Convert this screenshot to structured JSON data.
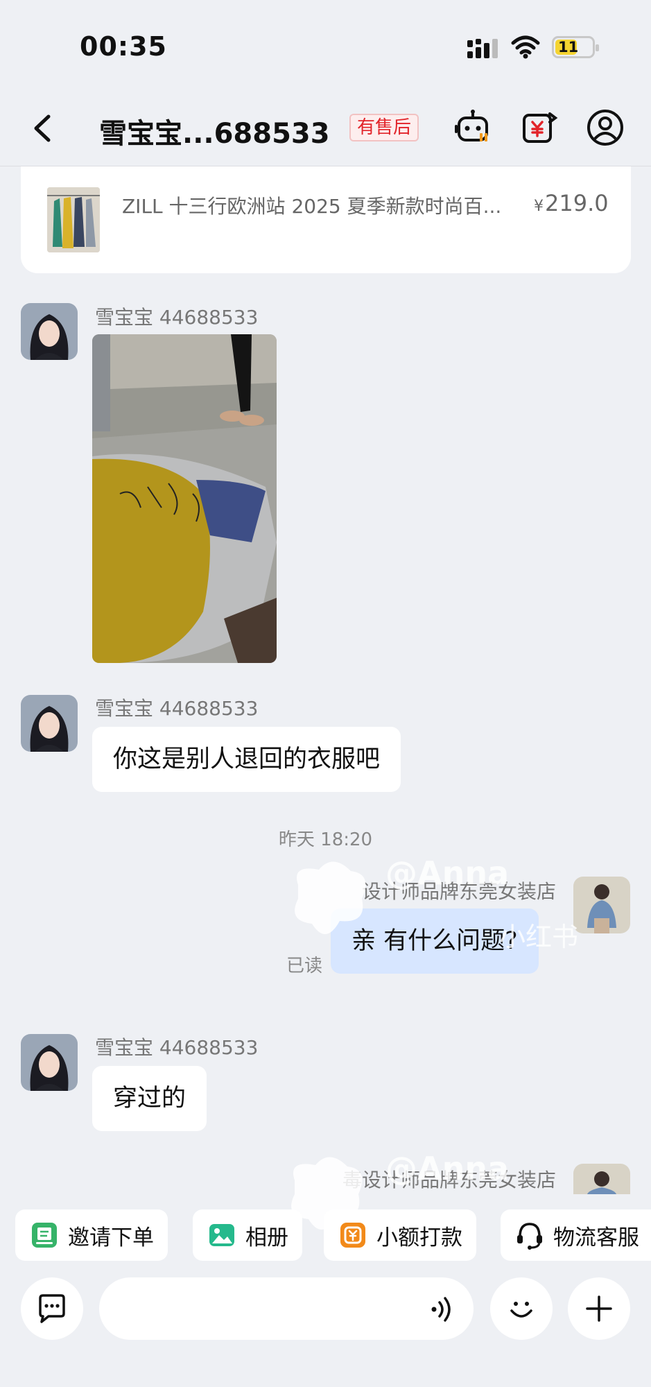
{
  "status_bar": {
    "time": "00:35",
    "battery": "11"
  },
  "nav": {
    "title": "雪宝宝...688533",
    "badge": "有售后"
  },
  "product": {
    "title": "ZILL 十三行欧洲站 2025 夏季新款时尚百...",
    "currency": "¥",
    "price": "219.0"
  },
  "messages": [
    {
      "sender": "雪宝宝 44688533",
      "type": "image"
    },
    {
      "sender": "雪宝宝 44688533",
      "type": "text",
      "text": "你这是别人退回的衣服吧"
    },
    {
      "timestamp": "昨天 18:20"
    },
    {
      "sender": "设计师品牌东莞女装店",
      "type": "text",
      "text": "亲 有什么问题?",
      "read": "已读",
      "mine": true
    },
    {
      "sender": "雪宝宝 44688533",
      "type": "text",
      "text": "穿过的"
    },
    {
      "sender": "毒设计师品牌东莞女装店",
      "mine": true
    }
  ],
  "watermark": {
    "text": "@Anna",
    "brand": "小红书"
  },
  "quick_actions": [
    {
      "label": "邀请下单",
      "icon": "invite-order-icon"
    },
    {
      "label": "相册",
      "icon": "album-icon"
    },
    {
      "label": "小额打款",
      "icon": "small-payment-icon"
    },
    {
      "label": "物流客服",
      "icon": "logistics-service-icon"
    }
  ],
  "input": {
    "placeholder": ""
  },
  "colors": {
    "background": "#eef0f4",
    "accent_red": "#e2242a",
    "my_bubble": "#d7e6ff",
    "battery": "#f5d431"
  }
}
